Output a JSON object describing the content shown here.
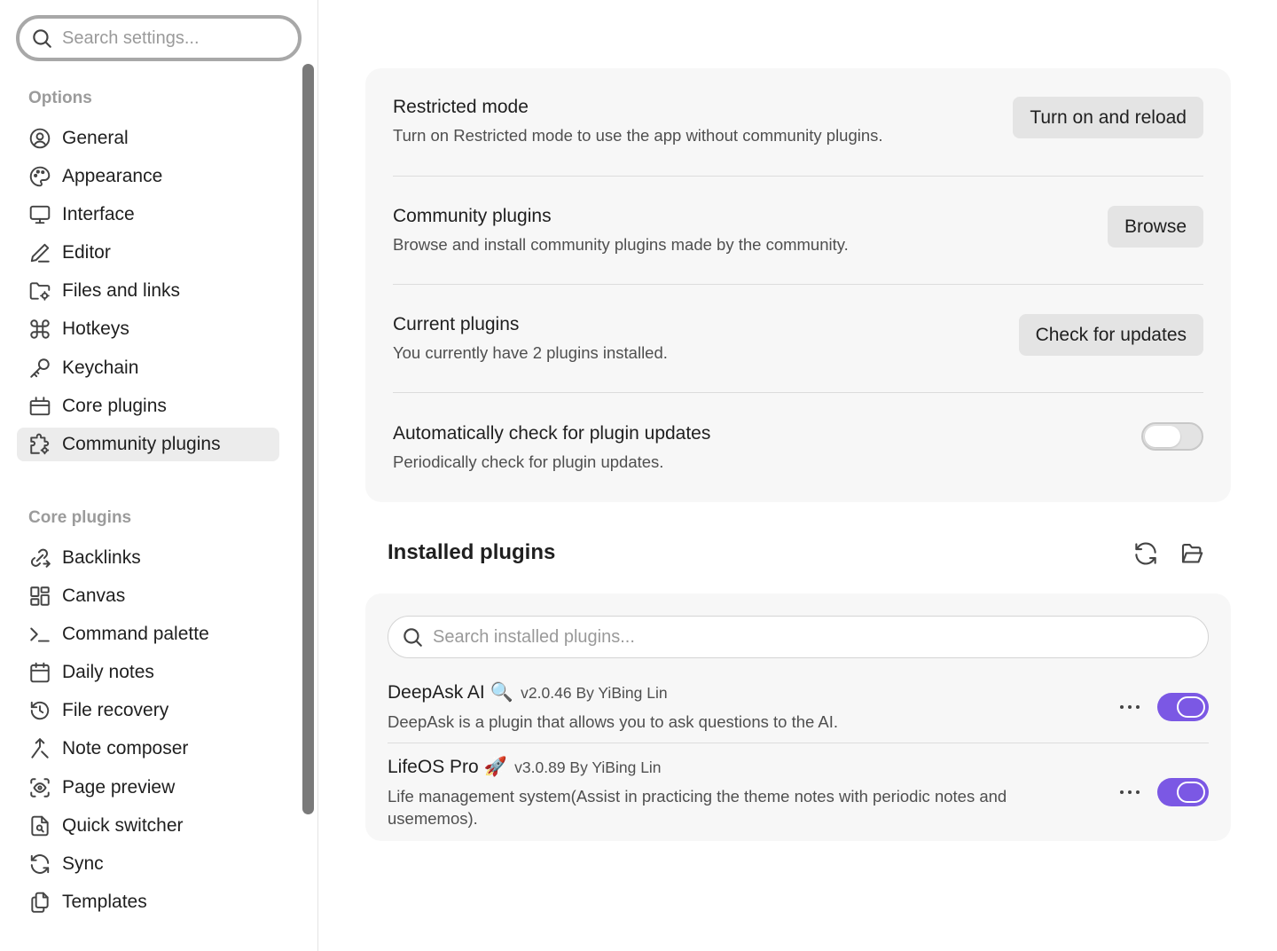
{
  "sidebar": {
    "search_placeholder": "Search settings...",
    "options_heading": "Options",
    "options": [
      {
        "label": "General",
        "icon": "user-circle-icon"
      },
      {
        "label": "Appearance",
        "icon": "palette-icon"
      },
      {
        "label": "Interface",
        "icon": "monitor-icon"
      },
      {
        "label": "Editor",
        "icon": "pencil-icon"
      },
      {
        "label": "Files and links",
        "icon": "folder-cog-icon"
      },
      {
        "label": "Hotkeys",
        "icon": "command-icon"
      },
      {
        "label": "Keychain",
        "icon": "key-icon"
      },
      {
        "label": "Core plugins",
        "icon": "plug-box-icon"
      },
      {
        "label": "Community plugins",
        "icon": "puzzle-cog-icon",
        "active": true
      }
    ],
    "core_heading": "Core plugins",
    "core_plugins": [
      {
        "label": "Backlinks",
        "icon": "backlink-icon"
      },
      {
        "label": "Canvas",
        "icon": "layout-dashboard-icon"
      },
      {
        "label": "Command palette",
        "icon": "terminal-icon"
      },
      {
        "label": "Daily notes",
        "icon": "calendar-icon"
      },
      {
        "label": "File recovery",
        "icon": "history-icon"
      },
      {
        "label": "Note composer",
        "icon": "merge-icon"
      },
      {
        "label": "Page preview",
        "icon": "scan-eye-icon"
      },
      {
        "label": "Quick switcher",
        "icon": "file-search-icon"
      },
      {
        "label": "Sync",
        "icon": "refresh-icon"
      },
      {
        "label": "Templates",
        "icon": "files-icon"
      }
    ]
  },
  "settings": {
    "restricted": {
      "title": "Restricted mode",
      "desc": "Turn on Restricted mode to use the app without community plugins.",
      "button": "Turn on and reload"
    },
    "community": {
      "title": "Community plugins",
      "desc": "Browse and install community plugins made by the community.",
      "button": "Browse"
    },
    "current": {
      "title": "Current plugins",
      "desc": "You currently have 2 plugins installed.",
      "button": "Check for updates"
    },
    "auto_check": {
      "title": "Automatically check for plugin updates",
      "desc": "Periodically check for plugin updates.",
      "enabled": false
    }
  },
  "installed": {
    "title": "Installed plugins",
    "search_placeholder": "Search installed plugins...",
    "plugins": [
      {
        "name": "DeepAsk AI 🔍",
        "meta": "v2.0.46 By YiBing Lin",
        "desc": "DeepAsk is a plugin that allows you to ask questions to the AI.",
        "enabled": true
      },
      {
        "name": "LifeOS Pro 🚀",
        "meta": "v3.0.89 By YiBing Lin",
        "desc": "Life management system(Assist in practicing the theme notes with periodic notes and usememos).",
        "enabled": true
      }
    ]
  },
  "colors": {
    "accent": "#7b58e4",
    "card_bg": "#f7f7f7",
    "active_nav": "#ececec"
  }
}
